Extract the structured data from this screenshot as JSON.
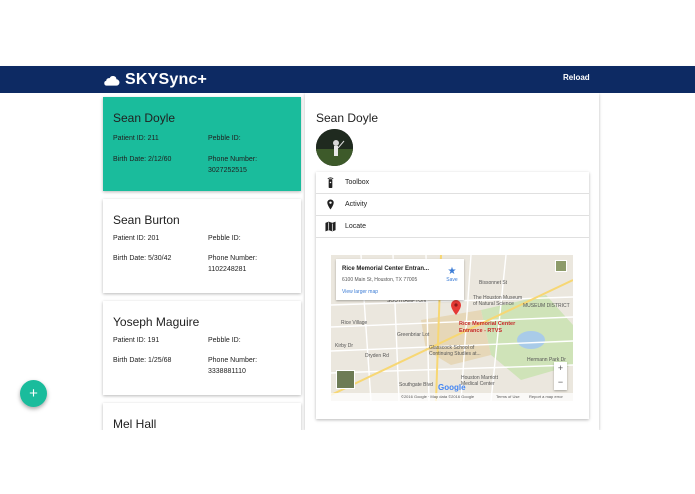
{
  "app": {
    "title": "SKYSync+",
    "reload_label": "Reload"
  },
  "patients": [
    {
      "name": "Sean Doyle",
      "patient_id": "Patient ID: 211",
      "pebble_id": "Pebble ID:",
      "birth_date": "Birth Date: 2/12/60",
      "phone_label": "Phone Number:",
      "phone": "3027252515"
    },
    {
      "name": "Sean Burton",
      "patient_id": "Patient ID: 201",
      "pebble_id": "Pebble ID:",
      "birth_date": "Birth Date: 5/30/42",
      "phone_label": "Phone Number:",
      "phone": "1102248281"
    },
    {
      "name": "Yoseph Maguire",
      "patient_id": "Patient ID: 191",
      "pebble_id": "Pebble ID:",
      "birth_date": "Birth Date: 1/25/68",
      "phone_label": "Phone Number:",
      "phone": "3338881110"
    },
    {
      "name": "Mel Hall"
    }
  ],
  "fab": {
    "label": "+"
  },
  "detail": {
    "name": "Sean Doyle",
    "menu": [
      {
        "label": "Toolbox",
        "icon": "remote-icon"
      },
      {
        "label": "Activity",
        "icon": "location-pin-icon"
      },
      {
        "label": "Locate",
        "icon": "map-icon"
      }
    ]
  },
  "map": {
    "place_name": "Rice Memorial Center Entran...",
    "address": "6100 Main St, Houston, TX 77005",
    "view_larger": "View larger map",
    "save_label": "Save",
    "pin_label_1": "Rice Memorial Center",
    "pin_label_2": "Entrance - RTVS",
    "zoom_in": "+",
    "zoom_out": "−",
    "google": "Google",
    "footer_data": "©2016 Google · Map data ©2016 Google",
    "footer_terms": "Terms of Use",
    "footer_report": "Report a map error",
    "labels": {
      "southampton": "SOUTHAMPTON",
      "rice_village": "Rice Village",
      "greenbriar": "Greenbriar Lot",
      "dryden": "Dryden Rd",
      "glasscock": "Glasscock School of",
      "glasscock2": "Continuing Studies at...",
      "museum": "The Houston Museum",
      "museum2": "of Natural Science",
      "museum_district": "MUSEUM DISTRICT",
      "southgate": "Southgate Blvd",
      "marriott": "Houston Marriott",
      "marriott2": "Medical Center",
      "bissonnet": "Bissonnet St",
      "kirby": "Kirby Dr",
      "hermann": "Hermann Park Dr"
    }
  },
  "colors": {
    "navbar": "#0d2a63",
    "accent": "#1abc9c"
  }
}
